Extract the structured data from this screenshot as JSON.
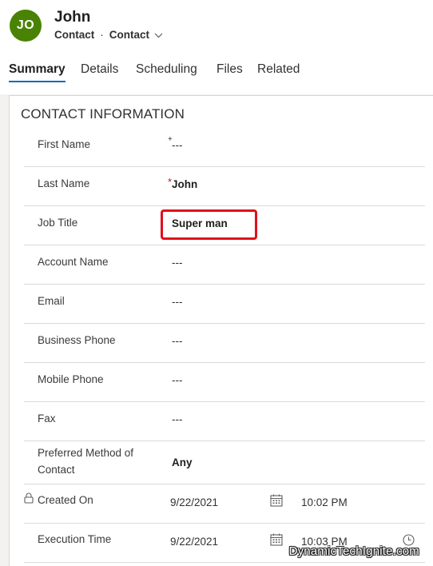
{
  "record": {
    "initials": "JO",
    "name": "John",
    "entity": "Contact",
    "separator": "·",
    "form_name": "Contact",
    "avatar_color": "#498205"
  },
  "tabs": [
    {
      "label": "Summary",
      "active": true
    },
    {
      "label": "Details",
      "active": false
    },
    {
      "label": "Scheduling",
      "active": false
    },
    {
      "label": "Files",
      "active": false
    },
    {
      "label": "Related",
      "active": false
    }
  ],
  "section": {
    "title": "CONTACT INFORMATION",
    "fields": [
      {
        "label": "First Name",
        "required_marker": "+",
        "value": "---"
      },
      {
        "label": "Last Name",
        "required_marker": "*",
        "value": "John"
      },
      {
        "label": "Job Title",
        "value": "Super man"
      },
      {
        "label": "Account Name",
        "value": "---"
      },
      {
        "label": "Email",
        "value": "---"
      },
      {
        "label": "Business Phone",
        "value": "---"
      },
      {
        "label": "Mobile Phone",
        "value": "---"
      },
      {
        "label": "Fax",
        "value": "---"
      },
      {
        "label": "Preferred Method of Contact",
        "value": "Any"
      },
      {
        "label": "Created On",
        "date": "9/22/2021",
        "time": "10:02 PM",
        "locked": true
      },
      {
        "label": "Execution Time",
        "date": "9/22/2021",
        "time": "10:03 PM"
      }
    ]
  },
  "watermark": "DynamicTechIgnite.com",
  "colors": {
    "tab_underline": "#0f6cbd",
    "required": "#a4262c",
    "highlight_box": "#e0101b"
  }
}
